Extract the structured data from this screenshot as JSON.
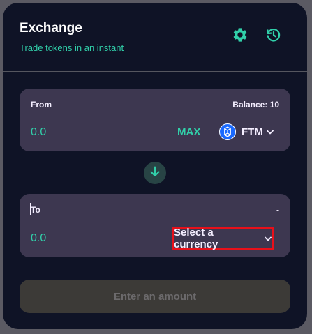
{
  "header": {
    "title": "Exchange",
    "subtitle": "Trade tokens in an instant",
    "settings_icon": "gear-icon",
    "history_icon": "history-icon"
  },
  "from": {
    "label": "From",
    "balance": "Balance: 10",
    "amount": "0.0",
    "max_label": "MAX",
    "token_symbol": "FTM",
    "token_icon": "fantom-logo-icon"
  },
  "swap_icon": "arrow-down-icon",
  "to": {
    "label": "To",
    "balance": "-",
    "amount": "0.0",
    "select_label": "Select a currency"
  },
  "submit": {
    "label": "Enter an amount",
    "disabled": true
  },
  "colors": {
    "background": "#0f1326",
    "panel": "#3d3750",
    "accent": "#31d0aa",
    "highlight": "#e8101a",
    "text": "#f4eeff",
    "disabled_button": "#3c3a37"
  }
}
